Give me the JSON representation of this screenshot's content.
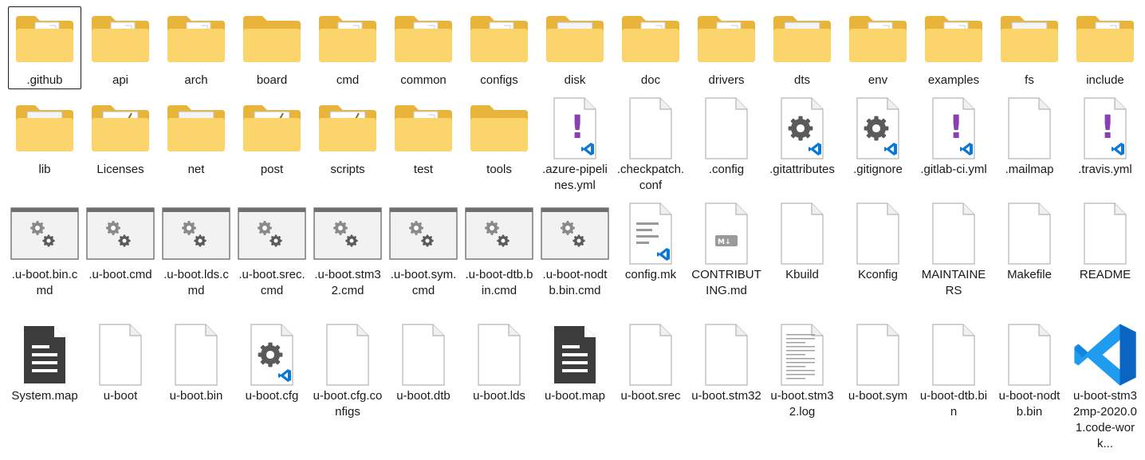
{
  "window": {
    "view": "large-icons",
    "selected_item": ".github"
  },
  "colors": {
    "folder_back": "#e9b43a",
    "folder_front": "#fbd56b",
    "file_page": "#ffffff",
    "file_border": "#b5b5b5",
    "vscode_blue": "#0a78d4",
    "yaml_purple": "#8b3fb5",
    "gear": "#5a5a5a"
  },
  "rows": [
    [
      {
        "name": ".github",
        "icon": "folder-doc-icon"
      },
      {
        "name": "api",
        "icon": "folder-doc-icon"
      },
      {
        "name": "arch",
        "icon": "folder-doc-icon"
      },
      {
        "name": "board",
        "icon": "folder-icon"
      },
      {
        "name": "cmd",
        "icon": "folder-doc-icon"
      },
      {
        "name": "common",
        "icon": "folder-doc-icon"
      },
      {
        "name": "configs",
        "icon": "folder-doc-icon"
      },
      {
        "name": "disk",
        "icon": "folder-gear-icon"
      },
      {
        "name": "doc",
        "icon": "folder-doc-icon"
      },
      {
        "name": "drivers",
        "icon": "folder-doc-icon"
      },
      {
        "name": "dts",
        "icon": "folder-gear-icon"
      },
      {
        "name": "env",
        "icon": "folder-doc-icon"
      },
      {
        "name": "examples",
        "icon": "folder-doc-icon"
      },
      {
        "name": "fs",
        "icon": "folder-gear-icon"
      },
      {
        "name": "include",
        "icon": "folder-doc-icon"
      }
    ],
    [
      {
        "name": "lib",
        "icon": "folder-gear-icon"
      },
      {
        "name": "Licenses",
        "icon": "folder-notepad-icon"
      },
      {
        "name": "net",
        "icon": "folder-gear-icon"
      },
      {
        "name": "post",
        "icon": "folder-notepad-icon"
      },
      {
        "name": "scripts",
        "icon": "folder-notepad-icon"
      },
      {
        "name": "test",
        "icon": "folder-doc-icon"
      },
      {
        "name": "tools",
        "icon": "folder-icon"
      },
      {
        "name": ".azure-pipelines.yml",
        "icon": "yaml-vscode-file-icon"
      },
      {
        "name": ".checkpatch.conf",
        "icon": "blank-file-icon"
      },
      {
        "name": ".config",
        "icon": "blank-file-icon"
      },
      {
        "name": ".gitattributes",
        "icon": "gear-vscode-file-icon"
      },
      {
        "name": ".gitignore",
        "icon": "gear-vscode-file-icon"
      },
      {
        "name": ".gitlab-ci.yml",
        "icon": "yaml-vscode-file-icon"
      },
      {
        "name": ".mailmap",
        "icon": "blank-file-icon"
      },
      {
        "name": ".travis.yml",
        "icon": "yaml-vscode-file-icon"
      }
    ],
    [
      {
        "name": ".u-boot.bin.cmd",
        "icon": "cmd-window-icon"
      },
      {
        "name": ".u-boot.cmd",
        "icon": "cmd-window-icon"
      },
      {
        "name": ".u-boot.lds.cmd",
        "icon": "cmd-window-icon"
      },
      {
        "name": ".u-boot.srec.cmd",
        "icon": "cmd-window-icon"
      },
      {
        "name": ".u-boot.stm32.cmd",
        "icon": "cmd-window-icon"
      },
      {
        "name": ".u-boot.sym.cmd",
        "icon": "cmd-window-icon"
      },
      {
        "name": ".u-boot-dtb.bin.cmd",
        "icon": "cmd-window-icon"
      },
      {
        "name": ".u-boot-nodtb.bin.cmd",
        "icon": "cmd-window-icon"
      },
      {
        "name": "config.mk",
        "icon": "text-vscode-file-icon"
      },
      {
        "name": "CONTRIBUTING.md",
        "icon": "markdown-file-icon"
      },
      {
        "name": "Kbuild",
        "icon": "blank-file-icon"
      },
      {
        "name": "Kconfig",
        "icon": "blank-file-icon"
      },
      {
        "name": "MAINTAINERS",
        "icon": "blank-file-icon"
      },
      {
        "name": "Makefile",
        "icon": "blank-file-icon"
      },
      {
        "name": "README",
        "icon": "blank-file-icon"
      }
    ],
    [
      {
        "name": "System.map",
        "icon": "dark-doc-icon"
      },
      {
        "name": "u-boot",
        "icon": "blank-file-icon"
      },
      {
        "name": "u-boot.bin",
        "icon": "blank-file-icon"
      },
      {
        "name": "u-boot.cfg",
        "icon": "gear-vscode-file-icon"
      },
      {
        "name": "u-boot.cfg.configs",
        "icon": "blank-file-icon"
      },
      {
        "name": "u-boot.dtb",
        "icon": "blank-file-icon"
      },
      {
        "name": "u-boot.lds",
        "icon": "blank-file-icon"
      },
      {
        "name": "u-boot.map",
        "icon": "dark-doc-icon"
      },
      {
        "name": "u-boot.srec",
        "icon": "blank-file-icon"
      },
      {
        "name": "u-boot.stm32",
        "icon": "blank-file-icon"
      },
      {
        "name": "u-boot.stm32.log",
        "icon": "log-file-icon"
      },
      {
        "name": "u-boot.sym",
        "icon": "blank-file-icon"
      },
      {
        "name": "u-boot-dtb.bin",
        "icon": "blank-file-icon"
      },
      {
        "name": "u-boot-nodtb.bin",
        "icon": "blank-file-icon"
      },
      {
        "name": "u-boot-stm32mp-2020.01.code-work...",
        "icon": "vscode-icon"
      }
    ]
  ]
}
